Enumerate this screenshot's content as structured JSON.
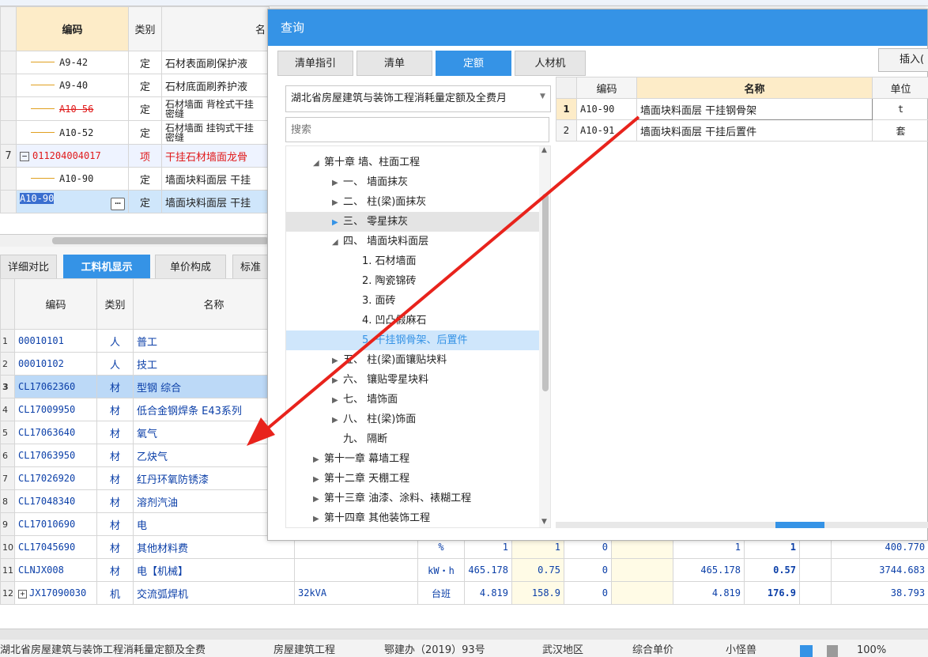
{
  "top_table": {
    "headers": {
      "code": "编码",
      "type": "类别",
      "name": "名"
    },
    "rows": [
      {
        "num": "",
        "code": "A9-42",
        "type": "定",
        "name": "石材表面刷保护液",
        "style": "normal"
      },
      {
        "num": "",
        "code": "A9-40",
        "type": "定",
        "name": "石材底面刷养护液",
        "style": "normal"
      },
      {
        "num": "",
        "code": "A10-56",
        "type": "定",
        "name": "石材墙面 背栓式干挂 密缝",
        "style": "strike"
      },
      {
        "num": "",
        "code": "A10-52",
        "type": "定",
        "name": "石材墙面 挂钩式干挂 密缝",
        "style": "normal"
      },
      {
        "num": "7",
        "code": "011204004017",
        "type": "项",
        "name": "干挂石材墙面龙骨",
        "style": "red"
      },
      {
        "num": "",
        "code": "A10-90",
        "type": "定",
        "name": "墙面块料面层 干挂",
        "style": "normal"
      },
      {
        "num": "",
        "code": "A10-90",
        "type": "定",
        "name": "墙面块料面层 干挂",
        "style": "selected"
      }
    ]
  },
  "bottom_tabs": [
    "详细对比",
    "工料机显示",
    "单价构成",
    "标准"
  ],
  "bottom_table": {
    "headers": {
      "code": "编码",
      "type": "类别",
      "name": "名称"
    },
    "rows": [
      {
        "num": "1",
        "code": "00010101",
        "type": "人",
        "name": "普工"
      },
      {
        "num": "2",
        "code": "00010102",
        "type": "人",
        "name": "技工"
      },
      {
        "num": "3",
        "code": "CL17062360",
        "type": "材",
        "name": "型钢 综合"
      },
      {
        "num": "4",
        "code": "CL17009950",
        "type": "材",
        "name": "低合金钢焊条 E43系列"
      },
      {
        "num": "5",
        "code": "CL17063640",
        "type": "材",
        "name": "氧气"
      },
      {
        "num": "6",
        "code": "CL17063950",
        "type": "材",
        "name": "乙炔气"
      },
      {
        "num": "7",
        "code": "CL17026920",
        "type": "材",
        "name": "红丹环氧防锈漆"
      },
      {
        "num": "8",
        "code": "CL17048340",
        "type": "材",
        "name": "溶剂汽油"
      },
      {
        "num": "9",
        "code": "CL17010690",
        "type": "材",
        "name": "电"
      },
      {
        "num": "10",
        "code": "CL17045690",
        "type": "材",
        "name": "其他材料费",
        "spec": "",
        "unit": "%",
        "c1": "1",
        "c2": "1",
        "c3": "0",
        "c4": "",
        "c5": "1",
        "c6": "1",
        "c7": "",
        "c8": "400.770"
      },
      {
        "num": "11",
        "code": "CLNJX008",
        "type": "材",
        "name": "电【机械】",
        "spec": "",
        "unit": "kW・h",
        "c1": "465.178",
        "c2": "0.75",
        "c3": "0",
        "c4": "",
        "c5": "465.178",
        "c6": "0.57",
        "c7": "",
        "c8": "3744.683"
      },
      {
        "num": "12",
        "code": "JX17090030",
        "type": "机",
        "name": "交流弧焊机",
        "spec": "32kVA",
        "unit": "台班",
        "c1": "4.819",
        "c2": "158.9",
        "c3": "0",
        "c4": "",
        "c5": "4.819",
        "c6": "176.9",
        "c7": "",
        "c8": "38.793"
      }
    ]
  },
  "dialog": {
    "title": "查询",
    "tabs": [
      "清单指引",
      "清单",
      "定额",
      "人材机"
    ],
    "active_tab": "定额",
    "insert_label": "插入(",
    "library": "湖北省房屋建筑与装饰工程消耗量定额及全费月",
    "search_placeholder": "搜索",
    "tree": [
      {
        "label": "第十章 墙、柱面工程",
        "level": 0,
        "arrow": "open"
      },
      {
        "label": "一、 墙面抹灰",
        "level": 1,
        "arrow": "closed"
      },
      {
        "label": "二、 柱(梁)面抹灰",
        "level": 1,
        "arrow": "closed"
      },
      {
        "label": "三、 零星抹灰",
        "level": 1,
        "arrow": "closed-blue",
        "hover": true
      },
      {
        "label": "四、 墙面块料面层",
        "level": 1,
        "arrow": "open"
      },
      {
        "label": "1. 石材墙面",
        "level": 2,
        "arrow": ""
      },
      {
        "label": "2. 陶瓷锦砖",
        "level": 2,
        "arrow": ""
      },
      {
        "label": "3. 面砖",
        "level": 2,
        "arrow": ""
      },
      {
        "label": "4. 凹凸假麻石",
        "level": 2,
        "arrow": ""
      },
      {
        "label": "5. 干挂钢骨架、后置件",
        "level": 2,
        "arrow": "",
        "selected": true
      },
      {
        "label": "五、 柱(梁)面镶贴块料",
        "level": 1,
        "arrow": "closed"
      },
      {
        "label": "六、 镶贴零星块料",
        "level": 1,
        "arrow": "closed"
      },
      {
        "label": "七、 墙饰面",
        "level": 1,
        "arrow": "closed"
      },
      {
        "label": "八、 柱(梁)饰面",
        "level": 1,
        "arrow": "closed"
      },
      {
        "label": "九、 隔断",
        "level": 1,
        "arrow": ""
      },
      {
        "label": "第十一章 幕墙工程",
        "level": 0,
        "arrow": "closed"
      },
      {
        "label": "第十二章 天棚工程",
        "level": 0,
        "arrow": "closed"
      },
      {
        "label": "第十三章 油漆、涂料、裱糊工程",
        "level": 0,
        "arrow": "closed"
      },
      {
        "label": "第十四章 其他装饰工程",
        "level": 0,
        "arrow": "closed"
      }
    ],
    "results_headers": {
      "code": "编码",
      "name": "名称",
      "unit": "单位"
    },
    "results": [
      {
        "num": "1",
        "code": "A10-90",
        "name": "墙面块料面层 干挂钢骨架",
        "unit": "t"
      },
      {
        "num": "2",
        "code": "A10-91",
        "name": "墙面块料面层 干挂后置件",
        "unit": "套"
      }
    ]
  },
  "status_bar": [
    "湖北省房屋建筑与装饰工程消耗量定额及全费",
    "房屋建筑工程",
    "鄂建办（2019）93号",
    "武汉地区",
    "综合单价",
    "小怪兽",
    "100%"
  ],
  "colors": {
    "accent": "#3593e6",
    "header_bg": "#fdecc8",
    "arrow": "#e8231c"
  }
}
